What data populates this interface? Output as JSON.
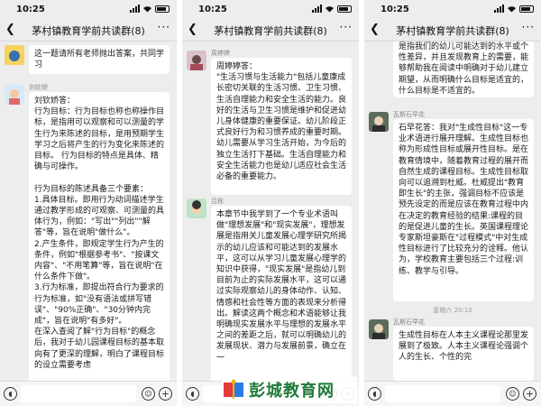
{
  "status": {
    "time": "10:25"
  },
  "chat_title": "茅村镇教育学前共读群(8)",
  "icons": {
    "back": "chevron-left-icon",
    "more": "more-dots-icon",
    "voice": "voice-icon",
    "emoji": "emoji-icon",
    "plus": "plus-icon"
  },
  "colors": {
    "chat_background": "#ededed",
    "bubble": "#ffffff",
    "watermark_green": "#1f7a3a"
  },
  "screens": [
    {
      "messages": [
        {
          "sender": "",
          "text": "这一题请所有老师抛出答案，共同学习"
        },
        {
          "sender": "刘钦娇",
          "text": "刘钦娇答：\n行为目标：行为目标也称也称操作目标，是指用可以观察和可以测量的学生行为来陈述的目标，是用预期学生学习之后将产生的行为变化来陈述的目标。 行为目标的特点是具体、精确与可操作。\n\n行为目标的陈述具备三个要素：\n1.具体目标。即用行为动词描述学生通过教学形成的可观察、可测量的具体行为，例如：\"写出\"\"列出\"\"解答\"等，旨在说明\"做什么\"。\n2.产生条件，即规定学生行为产生的条件，例如\"根据参考书\"、\"按课文内容\"、\"不用笔算\"等，旨在说明\"在什么条件下做\"。\n3.行为标准，即提出符合行为要求的行为标准，如\"没有语法或拼写错误\"、\"90%正确\"、\"30分钟内完成\"，旨在说明\"有多好\"。\n在深入查阅了解\"行为目标\"的概念后，我对于幼儿园课程目标的基本取向有了更深的理解，明白了课程目标的设立需要考虑"
        }
      ]
    },
    {
      "messages": [
        {
          "sender": "周婷婷",
          "text": "周婷婷答：\n\"生活习惯与生活能力\"包括儿童康成长密切关联的生活习惯、卫生习惯、生活自理能力和安全生活的能力。良好的生活与卫生习惯是维护和促进幼儿身体健康的重要保证。幼儿阶段正式良好行为和习惯养成的重要时期。\n幼儿需要从学习生活开始，为今后的独立生活打下基础。生活自理能力和安全生活能力也是幼儿适应社会生活必备的重要能力。"
        },
        {
          "sender": "吕栋",
          "text": "本章节中我学到了一个专业术语叫做\"理想发展\"和\"现实发展\"，理想发展是指用关儿童发展心理学研究所揭示的幼儿应该和可能达到的发展水平，这可以从学习儿童发展心理学的知识中获得，\"现实发展\"是指幼儿到目前为止的实际发展水平，这可以通过实际观察幼儿的身体动作、认知、情感和社会性等方面的表现来分析得出。解读这两个概念和术语能够让我明确现实发展水平与理想的发展水平之间的差距之后，就可以明确幼儿的发展现状、潜力与发展前景，确立在一"
        }
      ]
    },
    {
      "messages": [
        {
          "sender": "",
          "text": "是指我们的幼儿可能达到的水平或个性差异，并且发现教育上的需要，能够帮助我在阅读中明确对于幼儿建立期望，从而明确什么目标是适宜的，什么目标是不适宜的。"
        },
        {
          "sender": "瓦斯石早花",
          "text": "石早花答：我对\"生成性目标\"这一专业术语进行展开理解。生成性目标也称为形成性目标或展开性目标。是在教育情境中，随着教育过程的展开而自然生成的课程目标。生成性目标取向可以追溯到杜威。杜威提出\"教育即生长\"的主张，强调目标不应该是预先设定的而是应该在教育过程中内在决定的教育经验的结果:课程的目的是促进儿童的生长。英国课程理论专家斯坦豪斯在\"过程模式\"中对生成性目标进行了比较充分的诠释。他认为，学校教育主要包括三个过程:训练、教学与引导。"
        },
        {
          "sender": "瓦斯石早花",
          "text": "生成性目标在人本主义课程论那里发展到了极致。人本主义课程论强调个人的生长、个性的完"
        }
      ],
      "time_divider": "星期六 20:10"
    }
  ],
  "watermark": {
    "text": "彭城教育网"
  }
}
